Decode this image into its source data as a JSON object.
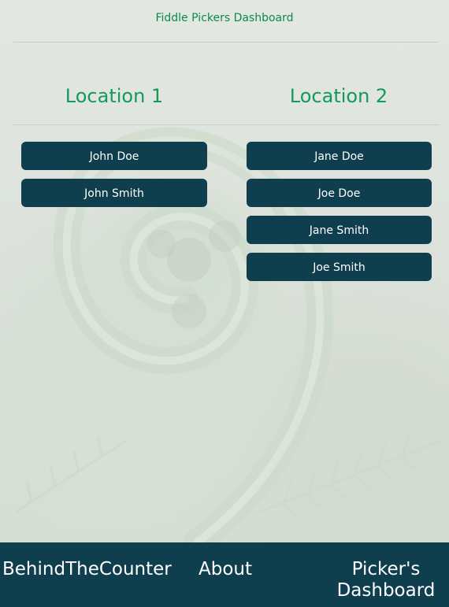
{
  "header": {
    "title": "Fiddle Pickers Dashboard"
  },
  "locations": [
    {
      "title": "Location 1",
      "pickers": [
        "John Doe",
        "John Smith"
      ]
    },
    {
      "title": "Location 2",
      "pickers": [
        "Jane Doe",
        "Joe Doe",
        "Jane Smith",
        "Joe Smith"
      ]
    }
  ],
  "footer": {
    "home": "BehindTheCounter",
    "about": "About",
    "dashboard": "Picker's Dashboard"
  },
  "colors": {
    "accent_green": "#129a5a",
    "button_bg": "#0f3f4f",
    "footer_bg": "#0f3f4f"
  },
  "background": {
    "icon": "fern-koru-photo"
  }
}
